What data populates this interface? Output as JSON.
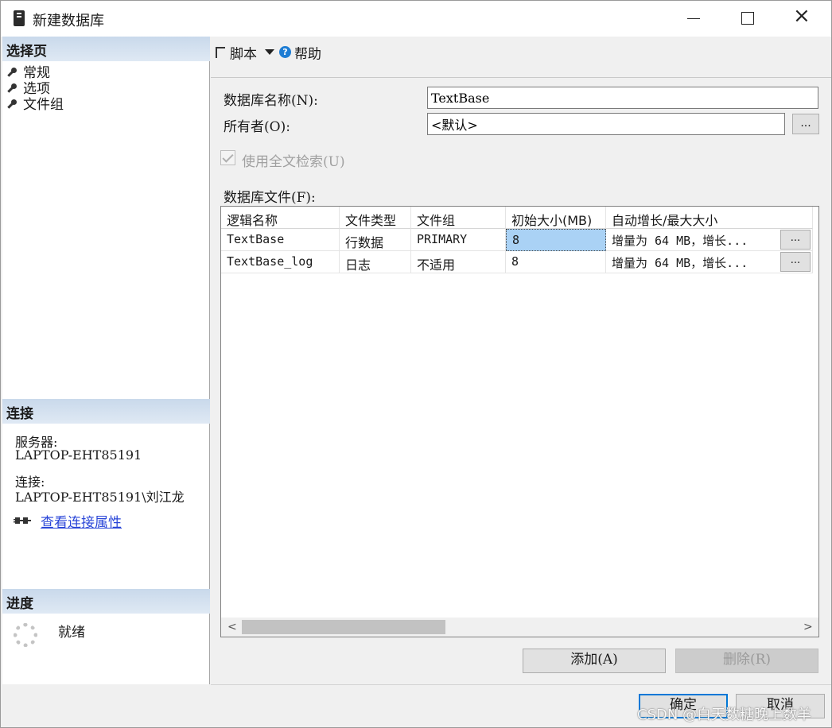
{
  "window": {
    "title": "新建数据库",
    "minimize": "—",
    "maximize": "☐",
    "close": "×"
  },
  "left": {
    "select_page_header": "选择页",
    "pages": [
      {
        "label": "常规"
      },
      {
        "label": "选项"
      },
      {
        "label": "文件组"
      }
    ],
    "connection_header": "连接",
    "server_label": "服务器:",
    "server_value": "LAPTOP-EHT85191",
    "connection_label": "连接:",
    "connection_value": "LAPTOP-EHT85191\\刘江龙",
    "view_props_link": "查看连接属性",
    "progress_header": "进度",
    "progress_status": "就绪"
  },
  "toolbar": {
    "script_label": "脚本",
    "help_label": "帮助"
  },
  "form": {
    "db_name_label": "数据库名称(N):",
    "db_name_value": "TextBase",
    "owner_label": "所有者(O):",
    "owner_value": "<默认>",
    "owner_browse": "...",
    "fulltext_label": "使用全文检索(U)",
    "fulltext_checked": true,
    "files_label": "数据库文件(F):"
  },
  "grid": {
    "columns": [
      "逻辑名称",
      "文件类型",
      "文件组",
      "初始大小(MB)",
      "自动增长/最大大小"
    ],
    "rows": [
      {
        "name": "TextBase",
        "type": "行数据",
        "filegroup": "PRIMARY",
        "size": "8",
        "growth": "增量为 64 MB，增长...",
        "browse": "..."
      },
      {
        "name": "TextBase_log",
        "type": "日志",
        "filegroup": "不适用",
        "size": "8",
        "growth": "增量为 64 MB，增长...",
        "browse": "..."
      }
    ],
    "scroll_left": "<",
    "scroll_right": ">"
  },
  "buttons": {
    "add": "添加(A)",
    "remove": "删除(R)",
    "ok": "确定",
    "cancel": "取消"
  },
  "watermark": "CSDN @白天数糖晚上数羊",
  "colors": {
    "header_bg": "#c9d9eb",
    "selection": "#aad2f5",
    "link": "#2a46d8",
    "accent": "#0078d7"
  }
}
